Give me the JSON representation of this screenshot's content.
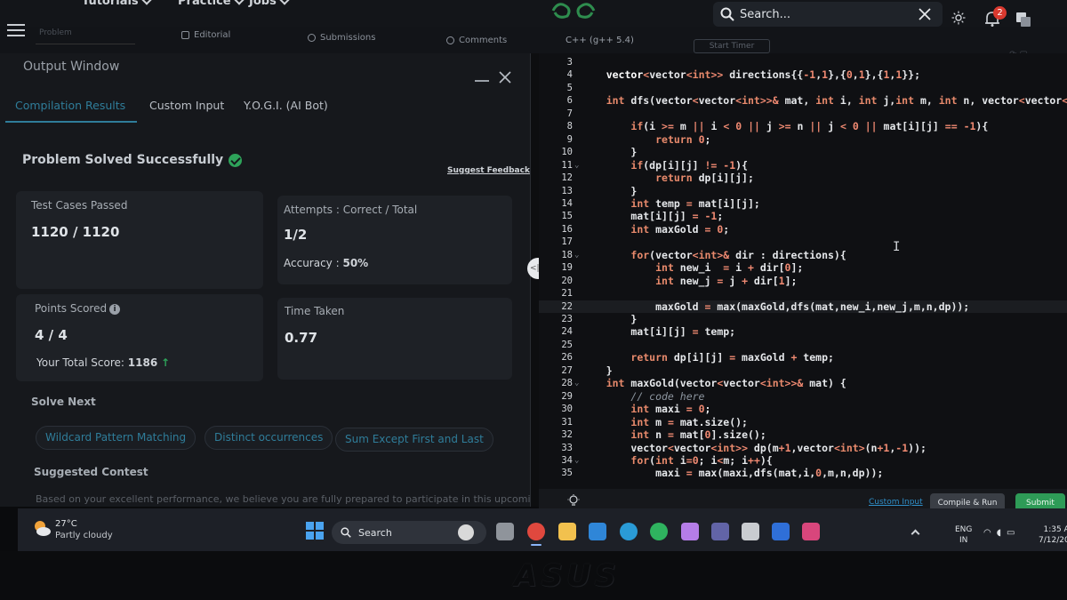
{
  "topnav": {
    "menus": [
      "Tutorials",
      "Practice",
      "Jobs"
    ],
    "search_placeholder": "Search...",
    "notification_count": "2"
  },
  "toolbar": {
    "problem_field": "Problem",
    "tabs": [
      "Editorial",
      "Submissions",
      "Comments"
    ],
    "language": "C++ (g++ 5.4)",
    "start_timer": "Start Timer"
  },
  "output": {
    "title": "Output Window",
    "tabs": [
      "Compilation Results",
      "Custom Input",
      "Y.O.G.I. (AI Bot)"
    ],
    "status": "Problem Solved Successfully",
    "feedback": "Suggest Feedback",
    "test_cases_label": "Test Cases Passed",
    "test_cases_value": "1120 / 1120",
    "attempts_label": "Attempts : Correct / Total",
    "attempts_value": "1/2",
    "accuracy_label": "Accuracy :",
    "accuracy_value": "50%",
    "points_label": "Points Scored",
    "points_value": "4 / 4",
    "total_score_label": "Your Total Score:",
    "total_score_value": "1186",
    "time_label": "Time Taken",
    "time_value": "0.77",
    "solve_next_label": "Solve Next",
    "solve_next": [
      "Wildcard Pattern Matching",
      "Distinct occurrences",
      "Sum Except First and Last"
    ],
    "suggested_contest_label": "Suggested Contest",
    "contest_desc": "Based on your excellent performance, we believe you are fully prepared to participate in this upcoming"
  },
  "editor": {
    "lines": [
      {
        "n": "3",
        "fold": false,
        "html": ""
      },
      {
        "n": "4",
        "fold": false,
        "html": "    <span class=\"t\">vector</span><span class=\"o\">&lt;</span>vector<span class=\"o\">&lt;</span><span class=\"k\">int</span><span class=\"o\">&gt;&gt;</span> directions{{<span class=\"n\">-1</span>,<span class=\"n\">1</span>},{<span class=\"n\">0</span>,<span class=\"n\">1</span>},{<span class=\"n\">1</span>,<span class=\"n\">1</span>}};"
      },
      {
        "n": "5",
        "fold": false,
        "html": ""
      },
      {
        "n": "6",
        "fold": false,
        "html": "    <span class=\"k\">int</span> dfs(vector<span class=\"o\">&lt;</span>vector<span class=\"o\">&lt;</span><span class=\"k\">int</span><span class=\"o\">&gt;&gt;&amp;</span> mat, <span class=\"k\">int</span> i, <span class=\"k\">int</span> j,<span class=\"k\">int</span> m, <span class=\"k\">int</span> n, vector<span class=\"o\">&lt;</span>vector<span class=\"o\">&lt;</span><span class=\"k\">int</span>"
      },
      {
        "n": "7",
        "fold": false,
        "html": ""
      },
      {
        "n": "8",
        "fold": false,
        "html": "        <span class=\"k\">if</span>(i <span class=\"o\">&gt;=</span> m <span class=\"o\">||</span> i <span class=\"o\">&lt;</span> <span class=\"n\">0</span> <span class=\"o\">||</span> j <span class=\"o\">&gt;=</span> n <span class=\"o\">||</span> j <span class=\"o\">&lt;</span> <span class=\"n\">0</span> <span class=\"o\">||</span> mat[i][j] <span class=\"o\">==</span> <span class=\"n\">-1</span>){"
      },
      {
        "n": "9",
        "fold": false,
        "html": "            <span class=\"k\">return</span> <span class=\"n\">0</span>;"
      },
      {
        "n": "10",
        "fold": false,
        "html": "        }"
      },
      {
        "n": "11",
        "fold": true,
        "html": "        <span class=\"k\">if</span>(dp[i][j] <span class=\"o\">!=</span> <span class=\"n\">-1</span>){"
      },
      {
        "n": "12",
        "fold": false,
        "html": "            <span class=\"k\">return</span> dp[i][j];"
      },
      {
        "n": "13",
        "fold": false,
        "html": "        }"
      },
      {
        "n": "14",
        "fold": false,
        "html": "        <span class=\"k\">int</span> temp <span class=\"o\">=</span> mat[i][j];"
      },
      {
        "n": "15",
        "fold": false,
        "html": "        mat[i][j] <span class=\"o\">=</span> <span class=\"n\">-1</span>;"
      },
      {
        "n": "16",
        "fold": false,
        "html": "        <span class=\"k\">int</span> maxGold <span class=\"o\">=</span> <span class=\"n\">0</span>;"
      },
      {
        "n": "17",
        "fold": false,
        "html": ""
      },
      {
        "n": "18",
        "fold": true,
        "html": "        <span class=\"k\">for</span>(vector<span class=\"o\">&lt;</span><span class=\"k\">int</span><span class=\"o\">&gt;&amp;</span> dir : directions){"
      },
      {
        "n": "19",
        "fold": false,
        "html": "            <span class=\"k\">int</span> new_i  <span class=\"o\">=</span> i <span class=\"o\">+</span> dir[<span class=\"n\">0</span>];"
      },
      {
        "n": "20",
        "fold": false,
        "html": "            <span class=\"k\">int</span> new_j <span class=\"o\">=</span> j <span class=\"o\">+</span> dir[<span class=\"n\">1</span>];"
      },
      {
        "n": "21",
        "fold": false,
        "html": ""
      },
      {
        "n": "22",
        "fold": false,
        "html": "            maxGold <span class=\"o\">=</span> max(maxGold,dfs(mat,new_i,new_j,m,n,dp));",
        "hl": true
      },
      {
        "n": "23",
        "fold": false,
        "html": "        }"
      },
      {
        "n": "24",
        "fold": false,
        "html": "        mat[i][j] <span class=\"o\">=</span> temp;"
      },
      {
        "n": "25",
        "fold": false,
        "html": ""
      },
      {
        "n": "26",
        "fold": false,
        "html": "        <span class=\"k\">return</span> dp[i][j] <span class=\"o\">=</span> maxGold <span class=\"o\">+</span> temp;"
      },
      {
        "n": "27",
        "fold": false,
        "html": "    }"
      },
      {
        "n": "28",
        "fold": true,
        "html": "    <span class=\"k\">int</span> maxGold(vector<span class=\"o\">&lt;</span>vector<span class=\"o\">&lt;</span><span class=\"k\">int</span><span class=\"o\">&gt;&gt;&amp;</span> mat) {"
      },
      {
        "n": "29",
        "fold": false,
        "html": "        <span class=\"c\">// code here</span>"
      },
      {
        "n": "30",
        "fold": false,
        "html": "        <span class=\"k\">int</span> maxi <span class=\"o\">=</span> <span class=\"n\">0</span>;"
      },
      {
        "n": "31",
        "fold": false,
        "html": "        <span class=\"k\">int</span> m <span class=\"o\">=</span> mat.size();"
      },
      {
        "n": "32",
        "fold": false,
        "html": "        <span class=\"k\">int</span> n <span class=\"o\">=</span> mat[<span class=\"n\">0</span>].size();"
      },
      {
        "n": "33",
        "fold": false,
        "html": "        vector<span class=\"o\">&lt;</span>vector<span class=\"o\">&lt;</span><span class=\"k\">int</span><span class=\"o\">&gt;&gt;</span> dp(m<span class=\"o\">+</span><span class=\"n\">1</span>,vector<span class=\"o\">&lt;</span><span class=\"k\">int</span><span class=\"o\">&gt;</span>(n<span class=\"o\">+</span><span class=\"n\">1</span>,<span class=\"n\">-1</span>));"
      },
      {
        "n": "34",
        "fold": true,
        "html": "        <span class=\"k\">for</span>(<span class=\"k\">int</span> i<span class=\"o\">=</span><span class=\"n\">0</span>; i<span class=\"o\">&lt;</span>m; i<span class=\"o\">++</span>){"
      },
      {
        "n": "35",
        "fold": false,
        "html": "            maxi <span class=\"o\">=</span> max(maxi,dfs(mat,i,<span class=\"n\">0</span>,m,n,dp));"
      }
    ],
    "custom_input": "Custom Input",
    "compile_run": "Compile & Run",
    "submit": "Submit"
  },
  "taskbar": {
    "temperature": "27°C",
    "condition": "Partly cloudy",
    "search": "Search",
    "lang_top": "ENG",
    "lang_bottom": "IN",
    "time": "1:35 A",
    "date": "7/12/20"
  },
  "bezel": {
    "brand": "ASUS"
  }
}
